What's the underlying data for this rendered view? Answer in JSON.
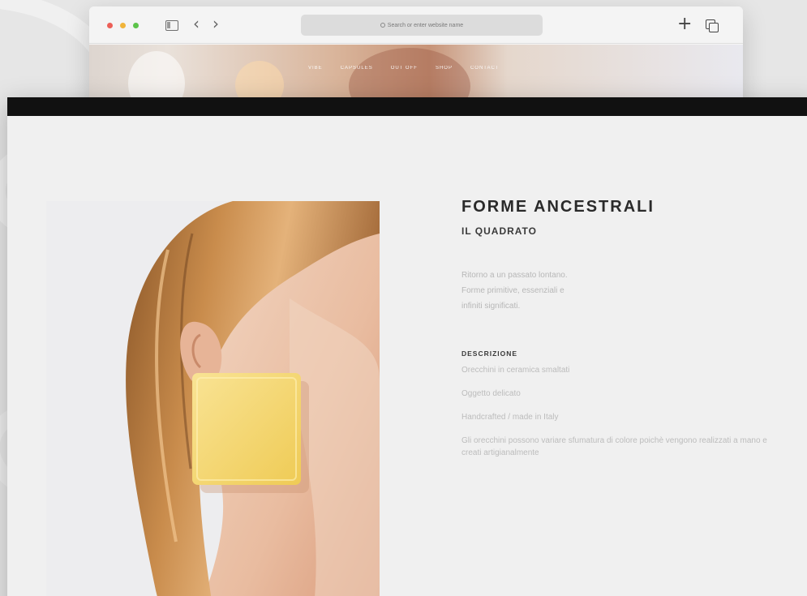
{
  "browser": {
    "address_placeholder": "Search or enter website name",
    "nav_items": [
      "Vibe",
      "Capsules",
      "Out Off",
      "Shop",
      "Contact"
    ]
  },
  "product": {
    "title": "FORME ANCESTRALI",
    "subtitle": "IL QUADRATO",
    "intro_lines": [
      "Ritorno a un passato lontano.",
      "Forme primitive, essenziali e",
      "infiniti significati."
    ],
    "description_heading": "DESCRIZIONE",
    "description_items": [
      "Orecchini in ceramica smaltati",
      "Oggetto delicato",
      "Handcrafted / made in Italy",
      "Gli orecchini possono variare sfumatura di colore poichè vengono realizzati a mano e creati artigianalmente"
    ]
  },
  "colors": {
    "background": "#e6e6e6",
    "page": "#f0f0f0",
    "topbar": "#111111",
    "earring": "#f5d96a",
    "hair": "#c1874a"
  },
  "icons": [
    "sidebar-toggle-icon",
    "back-arrow-icon",
    "forward-arrow-icon",
    "search-icon",
    "new-tab-plus-icon",
    "tabs-overview-icon"
  ]
}
